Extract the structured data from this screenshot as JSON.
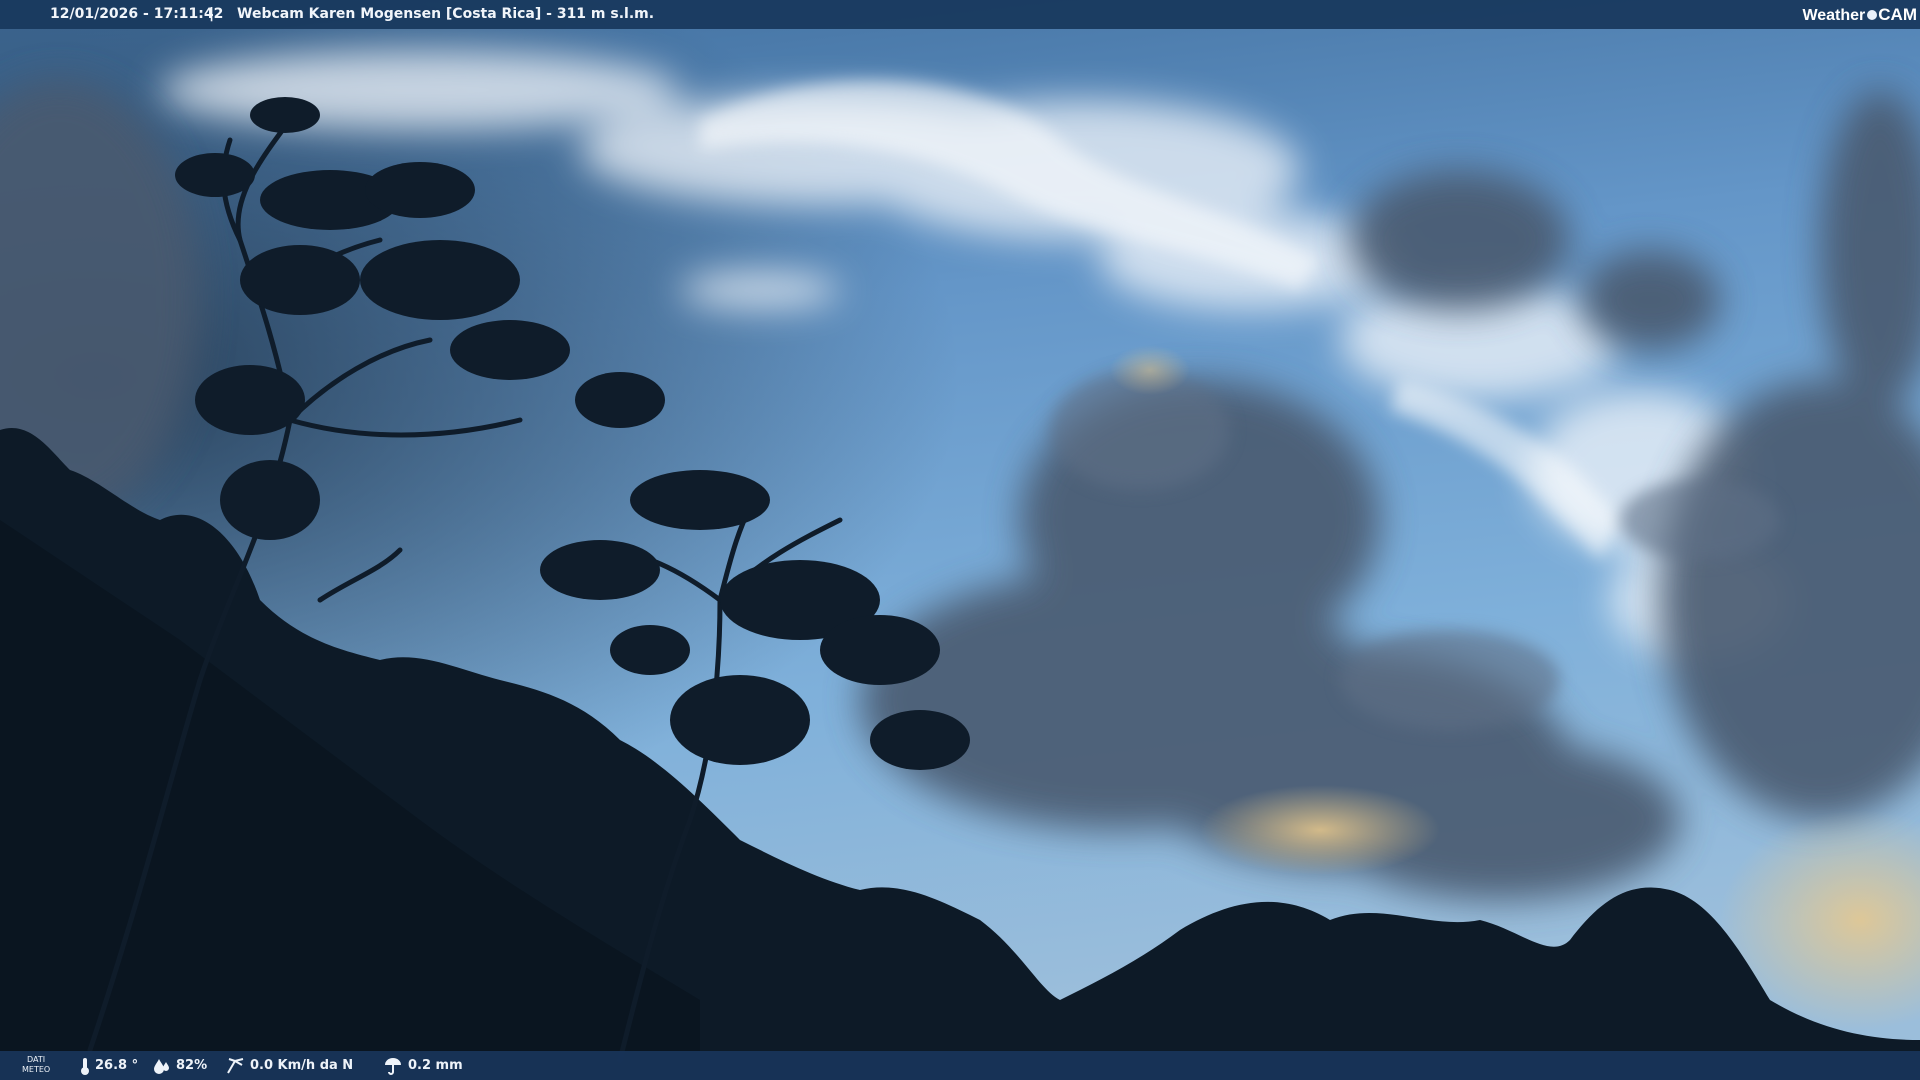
{
  "header": {
    "timestamp": "12/01/2026 - 17:11:42",
    "separator": "|",
    "title": "Webcam Karen Mogensen [Costa Rica] - 311 m s.l.m."
  },
  "brand": {
    "weather": "Weather",
    "cam": "CAM"
  },
  "footer": {
    "label_line1": "DATI",
    "label_line2": "METEO",
    "temperature": "26.8 °",
    "humidity": "82%",
    "wind": "0.0 Km/h da N",
    "rain": "0.2 mm"
  },
  "icons": [
    "thermometer-icon",
    "humidity-icon",
    "wind-icon",
    "rain-gauge-icon"
  ],
  "colors": {
    "bar": "#18385c",
    "text": "#f1f5fa",
    "sky": "#6a9ccf",
    "foliage": "#0d1a27"
  }
}
